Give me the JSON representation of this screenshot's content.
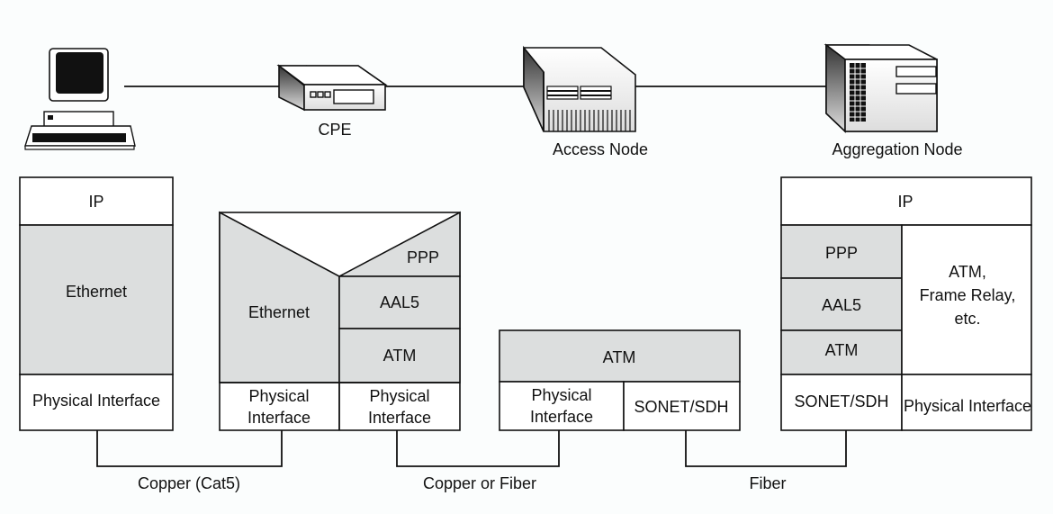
{
  "devices": {
    "cpe": "CPE",
    "access": "Access Node",
    "aggregation": "Aggregation Node"
  },
  "stack_pc": {
    "ip": "IP",
    "ethernet": "Ethernet",
    "phy": "Physical Interface"
  },
  "stack_cpe": {
    "ethernet": "Ethernet",
    "ppp": "PPP",
    "aal5": "AAL5",
    "atm": "ATM",
    "phy_left_1": "Physical",
    "phy_left_2": "Interface",
    "phy_right_1": "Physical",
    "phy_right_2": "Interface"
  },
  "stack_access": {
    "atm": "ATM",
    "phy_1": "Physical",
    "phy_2": "Interface",
    "sonet": "SONET/SDH"
  },
  "stack_agg": {
    "ip": "IP",
    "ppp": "PPP",
    "aal5": "AAL5",
    "atm": "ATM",
    "other_1": "ATM,",
    "other_2": "Frame Relay,",
    "other_3": "etc.",
    "sonet": "SONET/SDH",
    "phy": "Physical Interface"
  },
  "links": {
    "l1": "Copper (Cat5)",
    "l2": "Copper or Fiber",
    "l3": "Fiber"
  },
  "colors": {
    "layer_fill": "#dcdede",
    "line": "#111111"
  }
}
